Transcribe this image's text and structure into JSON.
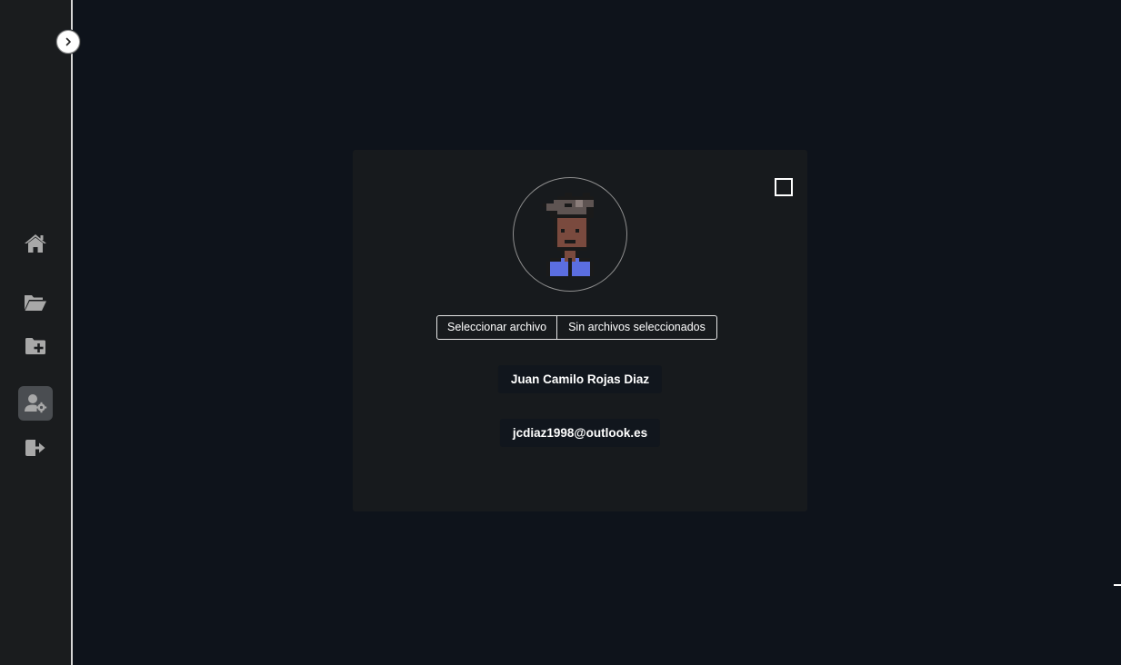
{
  "sidebar": {
    "toggle_icon": "chevron-right-icon",
    "items": [
      {
        "name": "home",
        "icon": "home-icon",
        "active": false
      },
      {
        "name": "folders",
        "icon": "folder-open-icon",
        "active": false
      },
      {
        "name": "new-folder",
        "icon": "folder-plus-icon",
        "active": false
      },
      {
        "name": "user-settings",
        "icon": "user-gear-icon",
        "active": true
      },
      {
        "name": "logout",
        "icon": "sign-out-icon",
        "active": false
      }
    ]
  },
  "profile": {
    "file_button_label": "Seleccionar archivo",
    "file_status": "Sin archivos seleccionados",
    "name": "Juan Camilo Rojas Diaz",
    "email": "jcdiaz1998@outlook.es"
  },
  "colors": {
    "background": "#0e131b",
    "sidebar": "#1a1c1e",
    "card": "#171a1d",
    "active_nav": "#4a4d51",
    "icon": "#a8a8a8"
  }
}
